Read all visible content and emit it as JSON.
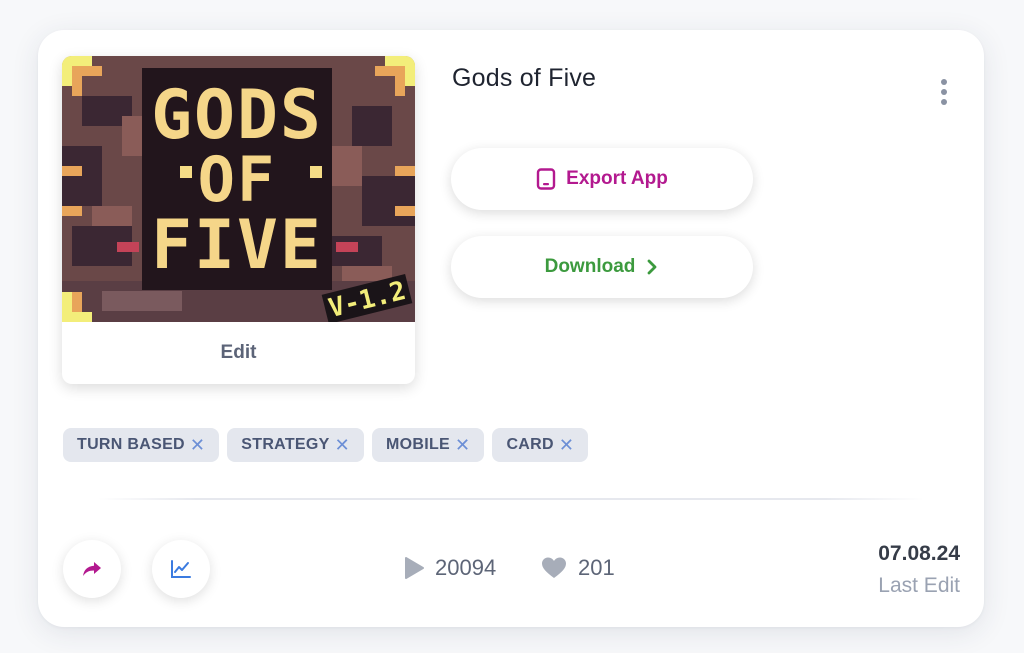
{
  "project": {
    "title": "Gods of Five",
    "cover": {
      "logo_text_line1": "GODS",
      "logo_text_line2": "OF",
      "logo_text_line3": "FIVE",
      "version_badge": "V-1.2"
    },
    "edit_label": "Edit"
  },
  "actions": {
    "export_label": "Export App",
    "download_label": "Download"
  },
  "tags": [
    {
      "label": "TURN BASED"
    },
    {
      "label": "STRATEGY"
    },
    {
      "label": "MOBILE"
    },
    {
      "label": "CARD"
    }
  ],
  "stats": {
    "plays": "20094",
    "likes": "201"
  },
  "meta": {
    "date": "07.08.24",
    "date_label": "Last Edit"
  },
  "icons": {
    "more": "more-vertical-icon",
    "export": "tablet-icon",
    "download": "chevron-right-icon",
    "share": "share-arrow-icon",
    "stats": "line-chart-icon",
    "plays": "play-icon",
    "likes": "heart-icon",
    "tag_remove": "close-icon"
  },
  "colors": {
    "export": "#b3198f",
    "download": "#3c9a3e",
    "share": "#b3198f",
    "stats": "#3b7be0",
    "tag_bg": "#e4e7ee",
    "tag_x": "#6c8fd6"
  }
}
